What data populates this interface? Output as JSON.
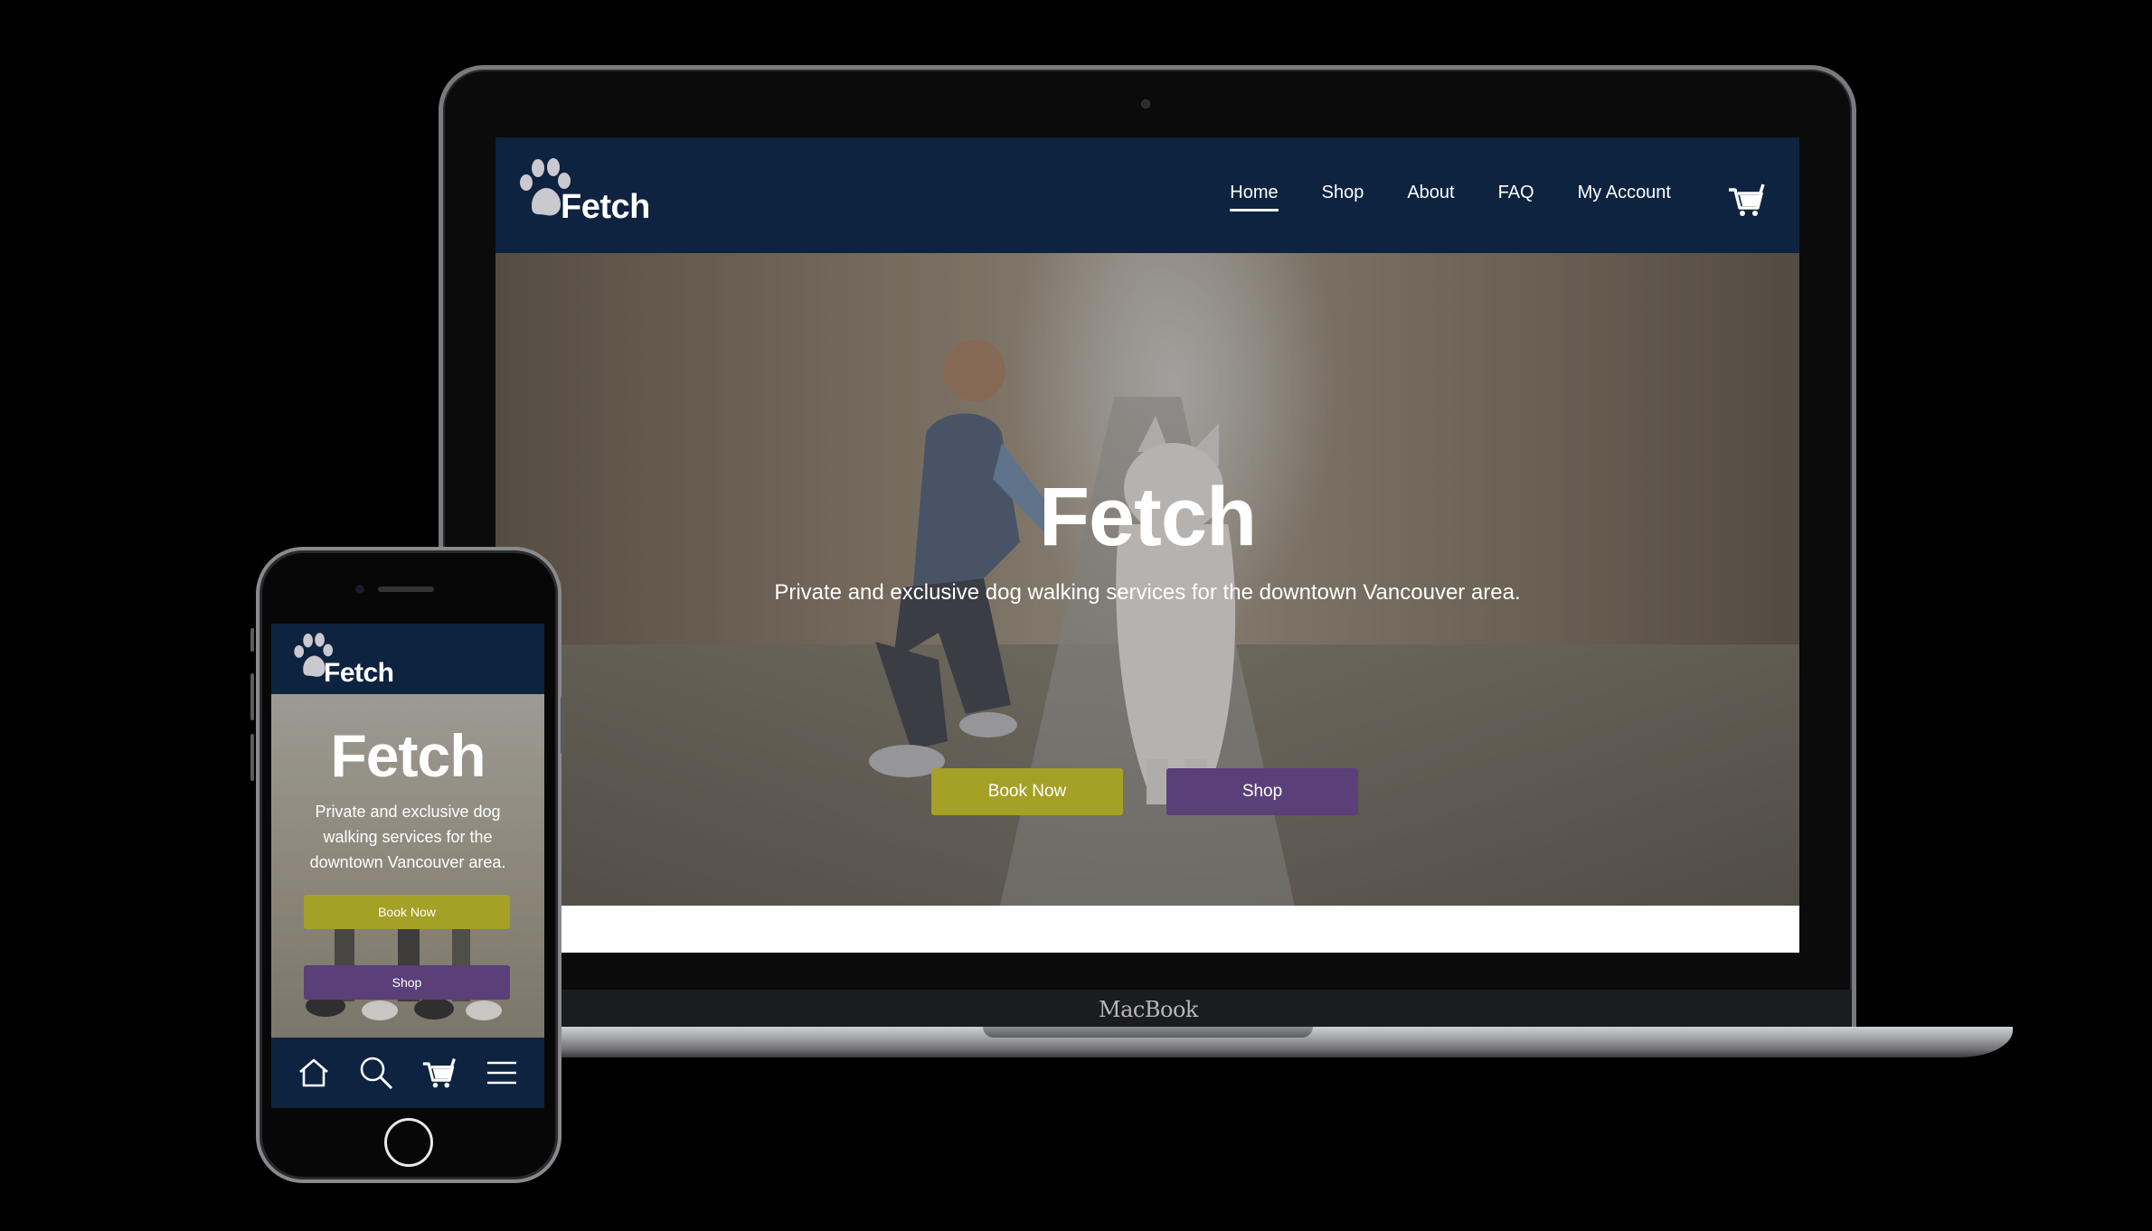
{
  "brand": {
    "name": "Fetch",
    "nav_color": "#0d2340",
    "book_color": "#a5a026",
    "shop_color": "#5a3f78"
  },
  "laptop": {
    "chin_label": "MacBook",
    "nav": {
      "items": [
        {
          "label": "Home",
          "active": true
        },
        {
          "label": "Shop",
          "active": false
        },
        {
          "label": "About",
          "active": false
        },
        {
          "label": "FAQ",
          "active": false
        },
        {
          "label": "My Account",
          "active": false
        }
      ],
      "cart_icon": "cart-icon"
    },
    "hero": {
      "title": "Fetch",
      "subtitle": "Private and exclusive dog walking services for the downtown Vancouver area.",
      "book_label": "Book Now",
      "shop_label": "Shop"
    }
  },
  "phone": {
    "hero": {
      "title": "Fetch",
      "subtitle": "Private and exclusive dog walking services for the downtown Vancouver area.",
      "book_label": "Book Now",
      "shop_label": "Shop"
    },
    "tabbar": [
      "home-icon",
      "search-icon",
      "cart-icon",
      "menu-icon"
    ]
  }
}
